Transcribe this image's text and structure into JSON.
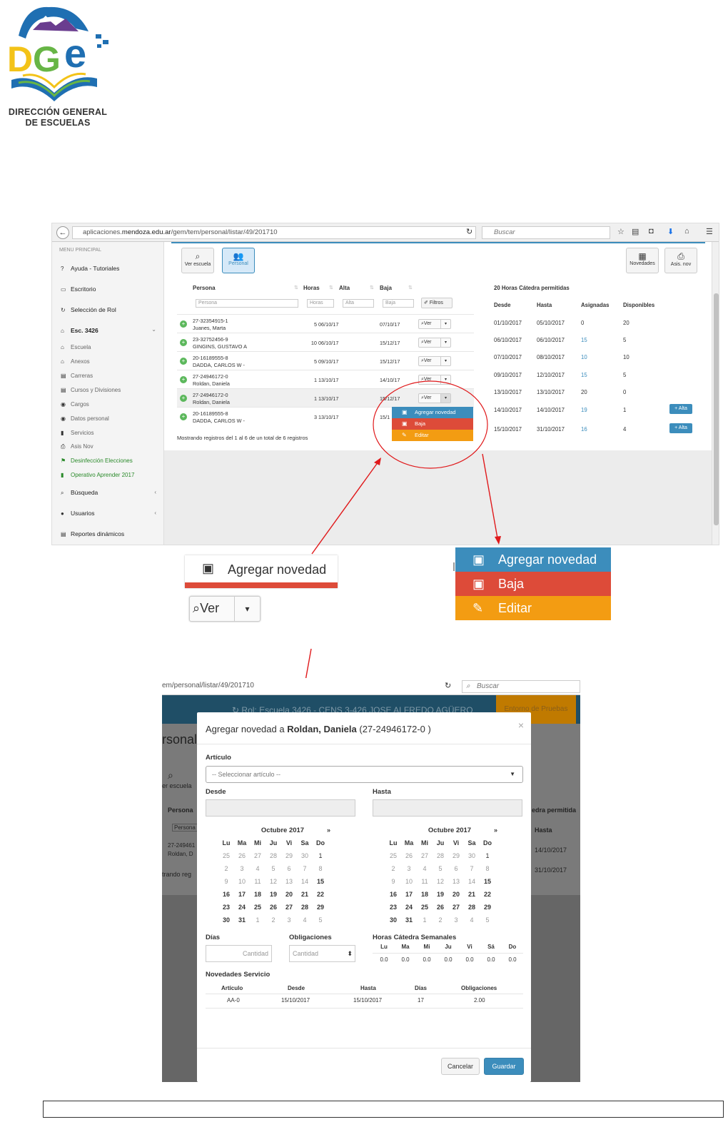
{
  "logo": {
    "org_line1": "DIRECCIÓN GENERAL",
    "org_line2": "DE ESCUELAS",
    "mark": "DGE",
    "colors": {
      "blue": "#1f6fb2",
      "yellow": "#f3c318",
      "green": "#67b546",
      "purple": "#6a3d8f"
    }
  },
  "browser1": {
    "url_prefix": "aplicaciones.",
    "url_domain": "mendoza.edu.ar",
    "url_path": "/gem/tem/personal/listar/49/201710",
    "search_placeholder": "Buscar",
    "sidebar": {
      "header": "MENU PRINCIPAL",
      "items": [
        {
          "icon": "?",
          "label": "Ayuda - Tutoriales"
        },
        {
          "icon": "▭",
          "label": "Escritorio"
        },
        {
          "icon": "↻",
          "label": "Selección de Rol"
        },
        {
          "icon": "⌂",
          "label": "Esc. 3426"
        },
        {
          "icon": "⌂",
          "label": "Escuela"
        },
        {
          "icon": "⌂",
          "label": "Anexos"
        },
        {
          "icon": "▤",
          "label": "Carreras"
        },
        {
          "icon": "▤",
          "label": "Cursos y Divisiones"
        },
        {
          "icon": "◉",
          "label": "Cargos"
        },
        {
          "icon": "◉",
          "label": "Datos personal"
        },
        {
          "icon": "▮",
          "label": "Servicios"
        },
        {
          "icon": "⎙",
          "label": "Asis Nov"
        },
        {
          "icon": "⚑",
          "label": "Desinfección Elecciones"
        },
        {
          "icon": "▮",
          "label": "Operativo Aprender 2017"
        },
        {
          "icon": "⌕",
          "label": "Búsqueda"
        },
        {
          "icon": "●",
          "label": "Usuarios"
        },
        {
          "icon": "▤",
          "label": "Reportes dinámicos"
        }
      ]
    },
    "toolbar": {
      "ver_escuela": "Ver escuela",
      "personal": "Personal",
      "novedades": "Novedades",
      "asis_nov": "Asis. nov"
    },
    "table": {
      "headers": {
        "persona": "Persona",
        "horas": "Horas",
        "alta": "Alta",
        "baja": "Baja"
      },
      "filters": {
        "persona": "Persona",
        "horas": "Horas",
        "alta": "Alta",
        "baja": "Baja",
        "filtros": "Filtros"
      },
      "rows": [
        {
          "cuil": "27-32354915-1",
          "name": "Juanes, Marta",
          "horas": "5",
          "alta": "06/10/17",
          "baja": "07/10/17"
        },
        {
          "cuil": "23-32752456-9",
          "name": "GINGINS, GUSTAVO A",
          "horas": "10",
          "alta": "06/10/17",
          "baja": "15/12/17"
        },
        {
          "cuil": "20-16189555-8",
          "name": "DADDA, CARLOS W -",
          "horas": "5",
          "alta": "09/10/17",
          "baja": "15/12/17"
        },
        {
          "cuil": "27-24946172-0",
          "name": "Roldan, Daniela",
          "horas": "1",
          "alta": "13/10/17",
          "baja": "14/10/17"
        },
        {
          "cuil": "27-24946172-0",
          "name": "Roldan, Daniela",
          "horas": "1",
          "alta": "13/10/17",
          "baja": "15/12/17"
        },
        {
          "cuil": "20-16189555-8",
          "name": "DADDA, CARLOS W -",
          "horas": "3",
          "alta": "13/10/17",
          "baja": "15/1"
        }
      ],
      "ver_label": "Ver",
      "footer": "Mostrando registros del 1 al 6 de un total de 6 registros"
    },
    "dropdown": {
      "agregar": "Agregar novedad",
      "baja": "Baja",
      "editar": "Editar"
    },
    "right": {
      "title": "20 Horas Cátedra permitidas",
      "headers": {
        "desde": "Desde",
        "hasta": "Hasta",
        "asignadas": "Asignadas",
        "disponibles": "Disponibles"
      },
      "rows": [
        {
          "desde": "01/10/2017",
          "hasta": "05/10/2017",
          "asignadas": "0",
          "disponibles": "20",
          "alta": ""
        },
        {
          "desde": "06/10/2017",
          "hasta": "06/10/2017",
          "asignadas": "15",
          "disponibles": "5",
          "alta": ""
        },
        {
          "desde": "07/10/2017",
          "hasta": "08/10/2017",
          "asignadas": "10",
          "disponibles": "10",
          "alta": ""
        },
        {
          "desde": "09/10/2017",
          "hasta": "12/10/2017",
          "asignadas": "15",
          "disponibles": "5",
          "alta": ""
        },
        {
          "desde": "13/10/2017",
          "hasta": "13/10/2017",
          "asignadas": "20",
          "disponibles": "0",
          "alta": ""
        },
        {
          "desde": "14/10/2017",
          "hasta": "14/10/2017",
          "asignadas": "19",
          "disponibles": "1",
          "alta": "+ Alta"
        },
        {
          "desde": "15/10/2017",
          "hasta": "31/10/2017",
          "asignadas": "16",
          "disponibles": "4",
          "alta": "+ Alta"
        }
      ]
    }
  },
  "zoom": {
    "agregar": "Agregar novedad",
    "ver": "Ver",
    "baja": "Baja",
    "editar": "Editar"
  },
  "browser2": {
    "url": "em/personal/listar/49/201710",
    "search_placeholder": "Buscar",
    "header_text": "Rol: Escuela 3426 - CENS 3-426 JOSE ALFREDO AGÜERO",
    "header_badge": "Entorno de Pruebas",
    "bg": {
      "rsonal": "rsonal",
      "ver_escuela": "er escuela",
      "persona": "Persona",
      "persona_filter": "Persona",
      "cuil": "27-249461",
      "name": "Roldan, D",
      "trando": "trando reg",
      "edra": "edra permitida",
      "hasta": "Hasta",
      "d1": "14/10/2017",
      "d2": "31/10/2017"
    },
    "modal": {
      "title_prefix": "Agregar novedad a ",
      "title_name": "Roldan, Daniela",
      "title_cuil": "(27-24946172-0 )",
      "articulo_label": "Artículo",
      "articulo_placeholder": "-- Seleccionar artículo --",
      "desde_label": "Desde",
      "hasta_label": "Hasta",
      "month": "Octubre 2017",
      "next": "»",
      "dow": [
        "Lu",
        "Ma",
        "Mi",
        "Ju",
        "Vi",
        "Sa",
        "Do"
      ],
      "weeks": [
        [
          "25",
          "26",
          "27",
          "28",
          "29",
          "30",
          "1"
        ],
        [
          "2",
          "3",
          "4",
          "5",
          "6",
          "7",
          "8"
        ],
        [
          "9",
          "10",
          "11",
          "12",
          "13",
          "14",
          "15"
        ],
        [
          "16",
          "17",
          "18",
          "19",
          "20",
          "21",
          "22"
        ],
        [
          "23",
          "24",
          "25",
          "26",
          "27",
          "28",
          "29"
        ],
        [
          "30",
          "31",
          "1",
          "2",
          "3",
          "4",
          "5"
        ]
      ],
      "dias_label": "Días",
      "dias_placeholder": "Cantidad",
      "obligaciones_label": "Obligaciones",
      "obligaciones_placeholder": "Cantidad",
      "hcs_label": "Horas Cátedra Semanales",
      "hcs_days": [
        "Lu",
        "Ma",
        "Mi",
        "Ju",
        "Vi",
        "Sá",
        "Do"
      ],
      "hcs_values": [
        "0.0",
        "0.0",
        "0.0",
        "0.0",
        "0.0",
        "0.0",
        "0.0"
      ],
      "novedades_label": "Novedades Servicio",
      "nov_headers": {
        "articulo": "Artículo",
        "desde": "Desde",
        "hasta": "Hasta",
        "dias": "Días",
        "obligaciones": "Obligaciones"
      },
      "nov_row": {
        "articulo": "AA-0",
        "desde": "15/10/2017",
        "hasta": "15/10/2017",
        "dias": "17",
        "obligaciones": "2.00"
      },
      "cancelar": "Cancelar",
      "guardar": "Guardar"
    }
  }
}
